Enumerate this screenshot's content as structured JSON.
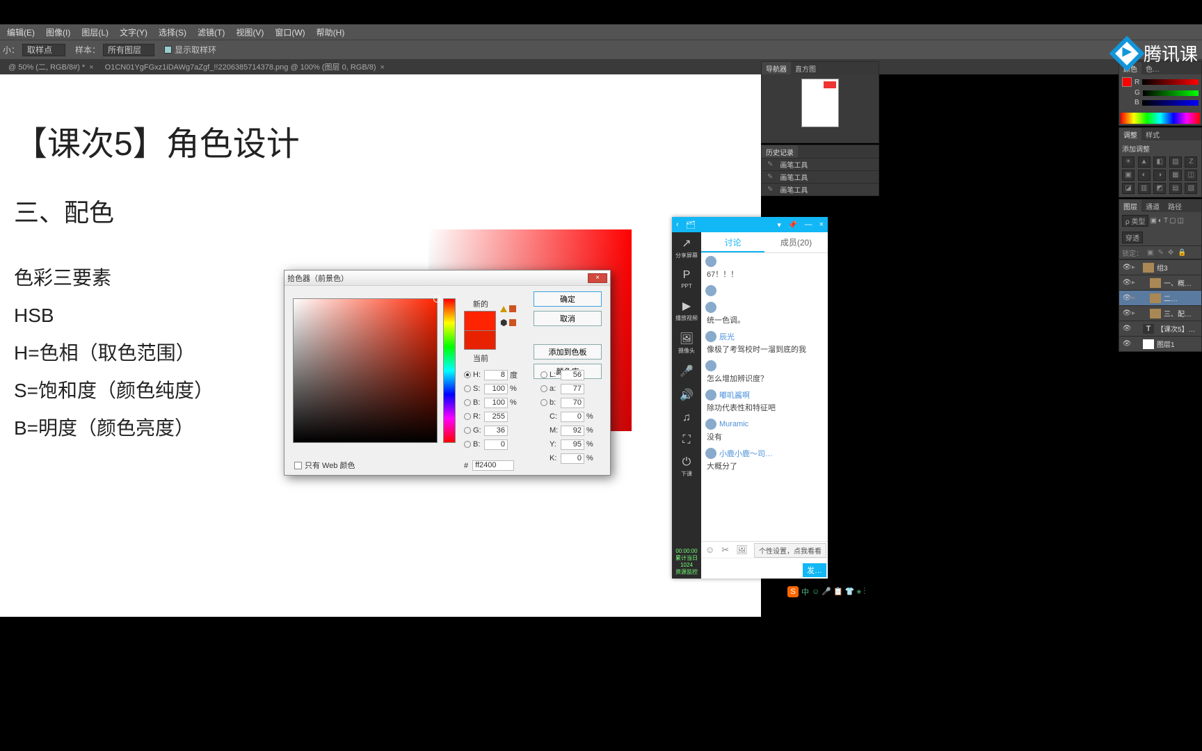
{
  "menubar": [
    "编辑(E)",
    "图像(I)",
    "图层(L)",
    "文字(Y)",
    "选择(S)",
    "滤镜(T)",
    "视图(V)",
    "窗口(W)",
    "帮助(H)"
  ],
  "optbar": {
    "size_label": "小：",
    "size_value": "取样点",
    "sample_label": "样本：",
    "sample_value": "所有图层",
    "show_ring_label": "显示取样环"
  },
  "tabs": [
    "@ 50% (二, RGB/8#) *",
    "O1CN01YgFGxz1iDAWg7aZgf_!!2206385714378.png @ 100% (图层 0, RGB/8)"
  ],
  "document": {
    "title": "【课次5】角色设计",
    "section": "三、配色",
    "lines": [
      "色彩三要素",
      "HSB",
      "H=色相（取色范围）",
      "S=饱和度（颜色纯度）",
      "B=明度（颜色亮度）"
    ]
  },
  "picker": {
    "title": "拾色器（前景色）",
    "new_label": "新的",
    "current_label": "当前",
    "ok": "确定",
    "cancel": "取消",
    "add_swatch": "添加到色板",
    "color_libs": "颜色库",
    "web_only": "只有 Web 颜色",
    "hex_label": "#",
    "hex_value": "ff2400",
    "hsb": {
      "H": "8",
      "H_u": "度",
      "S": "100",
      "S_u": "%",
      "B": "100",
      "B_u": "%"
    },
    "rgb": {
      "R": "255",
      "G": "36",
      "B": "0"
    },
    "lab": {
      "L": "56",
      "a": "77",
      "b": "70"
    },
    "cmyk": {
      "C": "0",
      "M": "92",
      "Y": "95",
      "K": "0"
    }
  },
  "panels": {
    "navigator_tabs": [
      "导航器",
      "直方图"
    ],
    "history_tab": "历史记录",
    "history_items": [
      "画笔工具",
      "画笔工具",
      "画笔工具"
    ],
    "color_tabs": [
      "颜色",
      "色…"
    ],
    "rgb_labels": [
      "R",
      "G",
      "B"
    ],
    "adjust_tabs": [
      "调整",
      "样式"
    ],
    "adjust_title": "添加调整",
    "layers_tabs": [
      "图层",
      "通道",
      "路径"
    ],
    "layers_kind": "ρ 类型",
    "layers_lock": "锁定：",
    "layers_pass": "穿透",
    "layers": [
      {
        "name": "组3",
        "type": "folder",
        "sel": false,
        "indent": 0
      },
      {
        "name": "一、概…",
        "type": "folder",
        "sel": false,
        "indent": 1
      },
      {
        "name": "二…",
        "type": "folder",
        "sel": true,
        "indent": 1
      },
      {
        "name": "三、配…",
        "type": "folder",
        "sel": false,
        "indent": 1
      },
      {
        "name": "【课次5】…",
        "type": "text",
        "sel": false,
        "indent": 0
      },
      {
        "name": "图层1",
        "type": "thumb",
        "sel": false,
        "indent": 0
      }
    ]
  },
  "txlogo": "腾讯课",
  "chat": {
    "tabs": {
      "discuss": "讨论",
      "members": "成员(20)"
    },
    "side": [
      {
        "icon": "↗",
        "label": "分享屏幕"
      },
      {
        "icon": "P",
        "label": "PPT"
      },
      {
        "icon": "▶",
        "label": "播放视频"
      },
      {
        "icon": "🖼",
        "label": "摄像头"
      }
    ],
    "side_icons": [
      "🎤",
      "🔊",
      "♫",
      "⛶",
      "⏻"
    ],
    "side_bottom": "下课",
    "timer": "00:00:00",
    "monitor": "累计当日\n1024\n资源监控",
    "messages": [
      {
        "name": "",
        "text": "67！！！"
      },
      {
        "name": "",
        "text": ""
      },
      {
        "name": "",
        "text": "统一色调。"
      },
      {
        "name": "辰光",
        "text": "像极了考驾校时一溜到底的我"
      },
      {
        "name": "  ",
        "text": "怎么增加辨识度？"
      },
      {
        "name": "嘟叽酱啊",
        "text": "除功代表性和特征吧"
      },
      {
        "name": "Muramic",
        "text": "没有"
      },
      {
        "name": "小鹿小鹿～司…",
        "text": "大概分了"
      }
    ],
    "tip": "个性设置，点我看看",
    "send": "发…"
  },
  "tray": {
    "ime": "S",
    "lang": "中",
    "icons": "☺ 🎤 📋 👕 ⚹ ⋮"
  }
}
